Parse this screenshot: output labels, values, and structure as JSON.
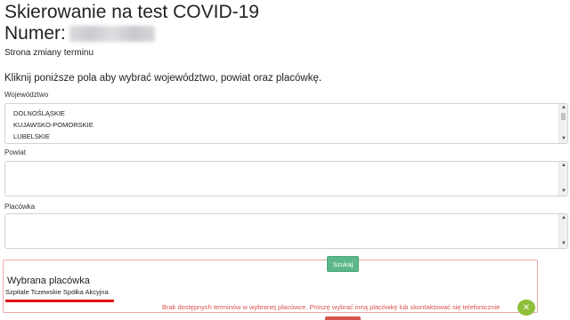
{
  "header": {
    "title": "Skierowanie na test COVID-19",
    "number_label": "Numer:",
    "subtitle": "Strona zmiany terminu"
  },
  "instructions": "Kliknij poniższe pola aby wybrać województwo, powiat oraz placówkę.",
  "voivodeship": {
    "label": "Województwo",
    "options": [
      "DOLNOŚLĄSKIE",
      "KUJAWSKO-POMORSKIE",
      "LUBELSKIE"
    ]
  },
  "county": {
    "label": "Powiat",
    "options": []
  },
  "facility": {
    "label": "Placówka",
    "options": []
  },
  "search_button": "Szukaj",
  "selected": {
    "title": "Wybrana placówka",
    "name": "Szpitale Tczewskie Spółka Akcyjna",
    "error": "Brak dostępnych terminów w wybranej placówce. Proszę wybrać inną placówkę lub skontaktować się telefonicznie"
  },
  "icons": {
    "scroll_up": "triangle-up-icon",
    "scroll_down": "triangle-down-icon",
    "badge": "close-badge-icon"
  },
  "colors": {
    "search_button": "#5cb88a",
    "error_text": "#d9534f",
    "panel_border": "#f0a7a7",
    "underline": "#e01010",
    "badge": "#8fbf3a"
  }
}
